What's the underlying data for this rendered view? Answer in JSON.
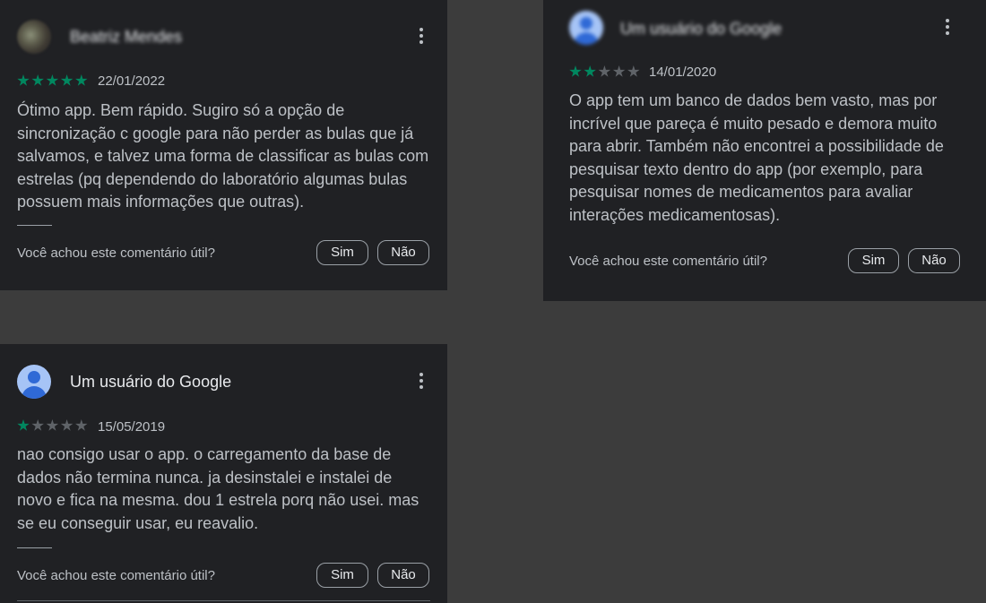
{
  "reviews": [
    {
      "author": "Beatriz Mendes",
      "rating": 5,
      "date": "22/01/2022",
      "text": "Ótimo app. Bem rápido. Sugiro só a opção de sincronização c google para não perder as bulas que já salvamos, e talvez uma forma de classificar as bulas com estrelas (pq dependendo do laboratório algumas bulas possuem mais informações que outras).",
      "helpful_prompt": "Você achou este comentário útil?",
      "yes_label": "Sim",
      "no_label": "Não",
      "avatar_icon": "user-photo-avatar"
    },
    {
      "author": "Um usuário do Google",
      "rating": 2,
      "date": "14/01/2020",
      "text": "O app tem um banco de dados bem vasto, mas por incrível que pareça é muito pesado e demora muito para abrir. Também não encontrei a possibilidade de pesquisar texto dentro do app (por exemplo, para pesquisar nomes de medicamentos para avaliar interações medicamentosas).",
      "helpful_prompt": "Você achou este comentário útil?",
      "yes_label": "Sim",
      "no_label": "Não",
      "avatar_icon": "google-user-avatar"
    },
    {
      "author": "Um usuário do Google",
      "rating": 1,
      "date": "15/05/2019",
      "text": "nao consigo usar o app. o carregamento da base de dados não termina nunca. ja desinstalei e instalei de novo e fica na mesma. dou 1 estrela porq não usei. mas se eu conseguir usar, eu reavalio.",
      "helpful_prompt": "Você achou este comentário útil?",
      "yes_label": "Sim",
      "no_label": "Não",
      "avatar_icon": "google-user-avatar"
    }
  ],
  "colors": {
    "background": "#3c3c3c",
    "card": "#202124",
    "star_filled": "#01875f",
    "star_empty": "#5f6368",
    "text_primary": "#e8eaed",
    "text_secondary": "#bdc1c6"
  }
}
